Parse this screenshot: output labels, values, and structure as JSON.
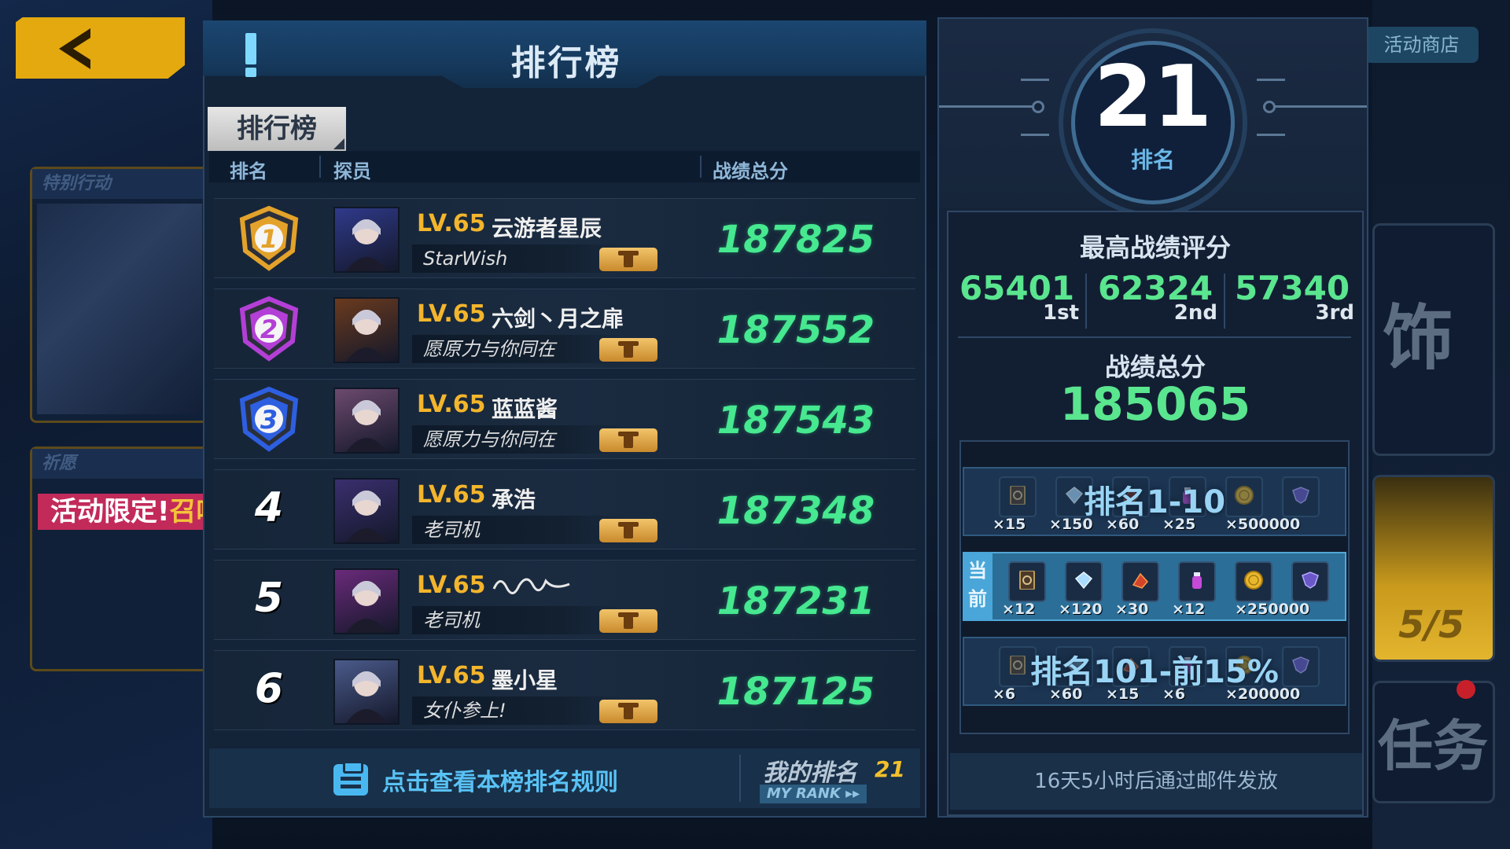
{
  "background": {
    "shop_button": "活动商店",
    "side_card_1_tag": "特别行动",
    "side_card_2_tag": "祈愿",
    "side_banner_white": "活动限定!",
    "side_banner_gold": "召唤",
    "right_card_text_1": "饰",
    "right_card_progress": "5/5",
    "right_card_text_2": "任务"
  },
  "panel": {
    "title": "排行榜",
    "tab_label": "排行榜",
    "columns": {
      "rank": "排名",
      "player": "探员",
      "score": "战绩总分"
    }
  },
  "rows": [
    {
      "rank": "1",
      "level": "LV.65",
      "name": "云游者星辰",
      "motto": "StarWish",
      "score": "187825",
      "badge_color": "#e3a22a",
      "avatar_bg": "#2f3a8a"
    },
    {
      "rank": "2",
      "level": "LV.65",
      "name": "六剑丶月之扉",
      "motto": "愿原力与你同在",
      "score": "187552",
      "badge_color": "#b33fd6",
      "avatar_bg": "#6a3a1e"
    },
    {
      "rank": "3",
      "level": "LV.65",
      "name": "蓝蓝酱",
      "motto": "愿原力与你同在",
      "score": "187543",
      "badge_color": "#2d5fe0",
      "avatar_bg": "#6c4a6e"
    },
    {
      "rank": "4",
      "level": "LV.65",
      "name": "承浩",
      "motto": "老司机",
      "score": "187348",
      "avatar_bg": "#3a2f6e"
    },
    {
      "rank": "5",
      "level": "LV.65",
      "name": "",
      "motto": "老司机",
      "score": "187231",
      "avatar_bg": "#6a2a7a"
    },
    {
      "rank": "6",
      "level": "LV.65",
      "name": "墨小星",
      "motto": "女仆参上!",
      "score": "187125",
      "avatar_bg": "#4a5a8a"
    }
  ],
  "footer": {
    "rules_link": "点击查看本榜排名规则",
    "my_rank_label": "我的排名",
    "my_rank_value": "21",
    "my_rank_button": "MY RANK ▸▸"
  },
  "summary": {
    "my_rank": "21",
    "my_rank_label": "排名",
    "best_title": "最高战绩评分",
    "best_scores": [
      {
        "value": "65401",
        "place": "1st"
      },
      {
        "value": "62324",
        "place": "2nd"
      },
      {
        "value": "57340",
        "place": "3rd"
      }
    ],
    "total_title": "战绩总分",
    "total_value": "185065"
  },
  "rewards": {
    "current_tag": "当前",
    "tiers": [
      {
        "label": "排名1-10",
        "current": false,
        "items": [
          {
            "icon": "card-icon",
            "qty": "×15"
          },
          {
            "icon": "crystal-icon",
            "qty": "×150"
          },
          {
            "icon": "material-icon",
            "qty": "×60"
          },
          {
            "icon": "exp-potion-icon",
            "qty": "×25"
          },
          {
            "icon": "gold-coin-icon",
            "qty": "×500000"
          },
          {
            "icon": "emblem-icon",
            "qty": ""
          }
        ]
      },
      {
        "label": "",
        "current": true,
        "items": [
          {
            "icon": "card-icon",
            "qty": "×12"
          },
          {
            "icon": "crystal-icon",
            "qty": "×120"
          },
          {
            "icon": "material-icon",
            "qty": "×30"
          },
          {
            "icon": "exp-potion-icon",
            "qty": "×12"
          },
          {
            "icon": "gold-coin-icon",
            "qty": "×250000"
          },
          {
            "icon": "emblem-icon",
            "qty": ""
          }
        ]
      },
      {
        "label": "排名101-前15%",
        "current": false,
        "items": [
          {
            "icon": "card-icon",
            "qty": "×6"
          },
          {
            "icon": "crystal-icon",
            "qty": "×60"
          },
          {
            "icon": "material-icon",
            "qty": "×15"
          },
          {
            "icon": "exp-potion-icon",
            "qty": "×6"
          },
          {
            "icon": "gold-coin-icon",
            "qty": "×200000"
          },
          {
            "icon": "emblem-icon",
            "qty": ""
          }
        ]
      }
    ],
    "mail_note": "16天5小时后通过邮件发放"
  },
  "colors": {
    "score_green": "#46e890",
    "level_gold": "#f3b52c",
    "accent_blue": "#59c2f5"
  }
}
